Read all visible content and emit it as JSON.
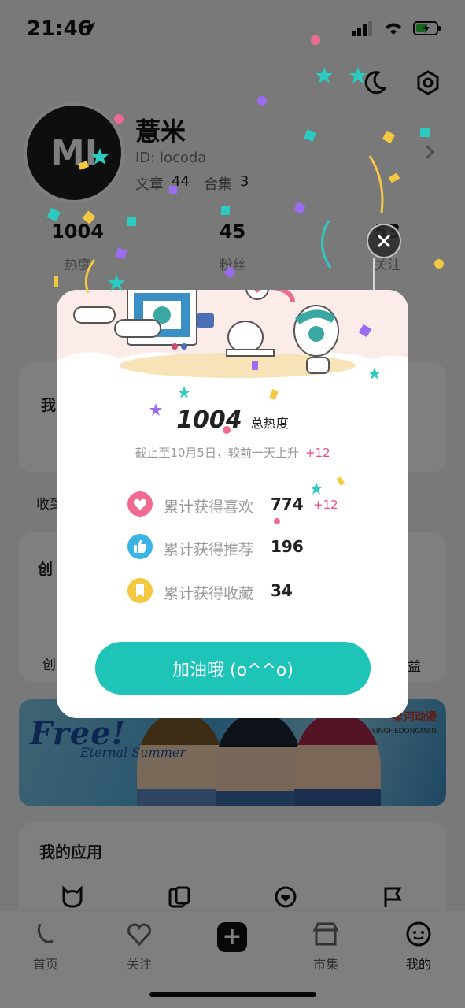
{
  "status_bar": {
    "time": "21:46"
  },
  "profile": {
    "avatar_text": "MI",
    "name": "薏米",
    "id_text": "ID: locoda",
    "articles_label": "文章",
    "articles_count": "44",
    "collections_label": "合集",
    "collections_count": "3"
  },
  "stats": [
    {
      "value": "1004",
      "label": "热度"
    },
    {
      "value": "45",
      "label": "粉丝"
    },
    {
      "value": "53",
      "label": "关注"
    }
  ],
  "background_sections": {
    "my_label": "我",
    "favorites_label": "收到",
    "create_label": "创",
    "create_row_left": "创",
    "create_row_right": "益"
  },
  "banner": {
    "title": "Free!",
    "subtitle": "Eternal Summer",
    "logo_text": "星河动漫",
    "logo_sub": "YINGHEDONGMAN"
  },
  "apps": {
    "title": "我的应用",
    "icons": [
      "cat-app-icon",
      "cards-app-icon",
      "heart-circle-app-icon",
      "flag-app-icon"
    ]
  },
  "tabbar": {
    "tabs": [
      {
        "label": "首页",
        "icon": "home-icon"
      },
      {
        "label": "关注",
        "icon": "heart-icon"
      },
      {
        "label": "市集",
        "icon": "shop-icon"
      },
      {
        "label": "我的",
        "icon": "face-icon"
      }
    ]
  },
  "dialog": {
    "total_value": "1004",
    "total_label": "总热度",
    "note": "截止至10月5日，较前一天上升",
    "note_delta": "+12",
    "metrics": [
      {
        "label": "累计获得喜欢",
        "value": "774",
        "delta": "+12",
        "icon": "heart-icon",
        "color": "#f06a92"
      },
      {
        "label": "累计获得推荐",
        "value": "196",
        "delta": "",
        "icon": "thumbs-up-icon",
        "color": "#3bb4e5"
      },
      {
        "label": "累计获得收藏",
        "value": "34",
        "delta": "",
        "icon": "bookmark-icon",
        "color": "#f5c842"
      }
    ],
    "cta_label": "加油哦 (o^^o)"
  },
  "colors": {
    "accent": "#1ec4b8",
    "delta_pink": "#e84c8a",
    "overlay": "rgba(0,0,0,0.5)"
  }
}
